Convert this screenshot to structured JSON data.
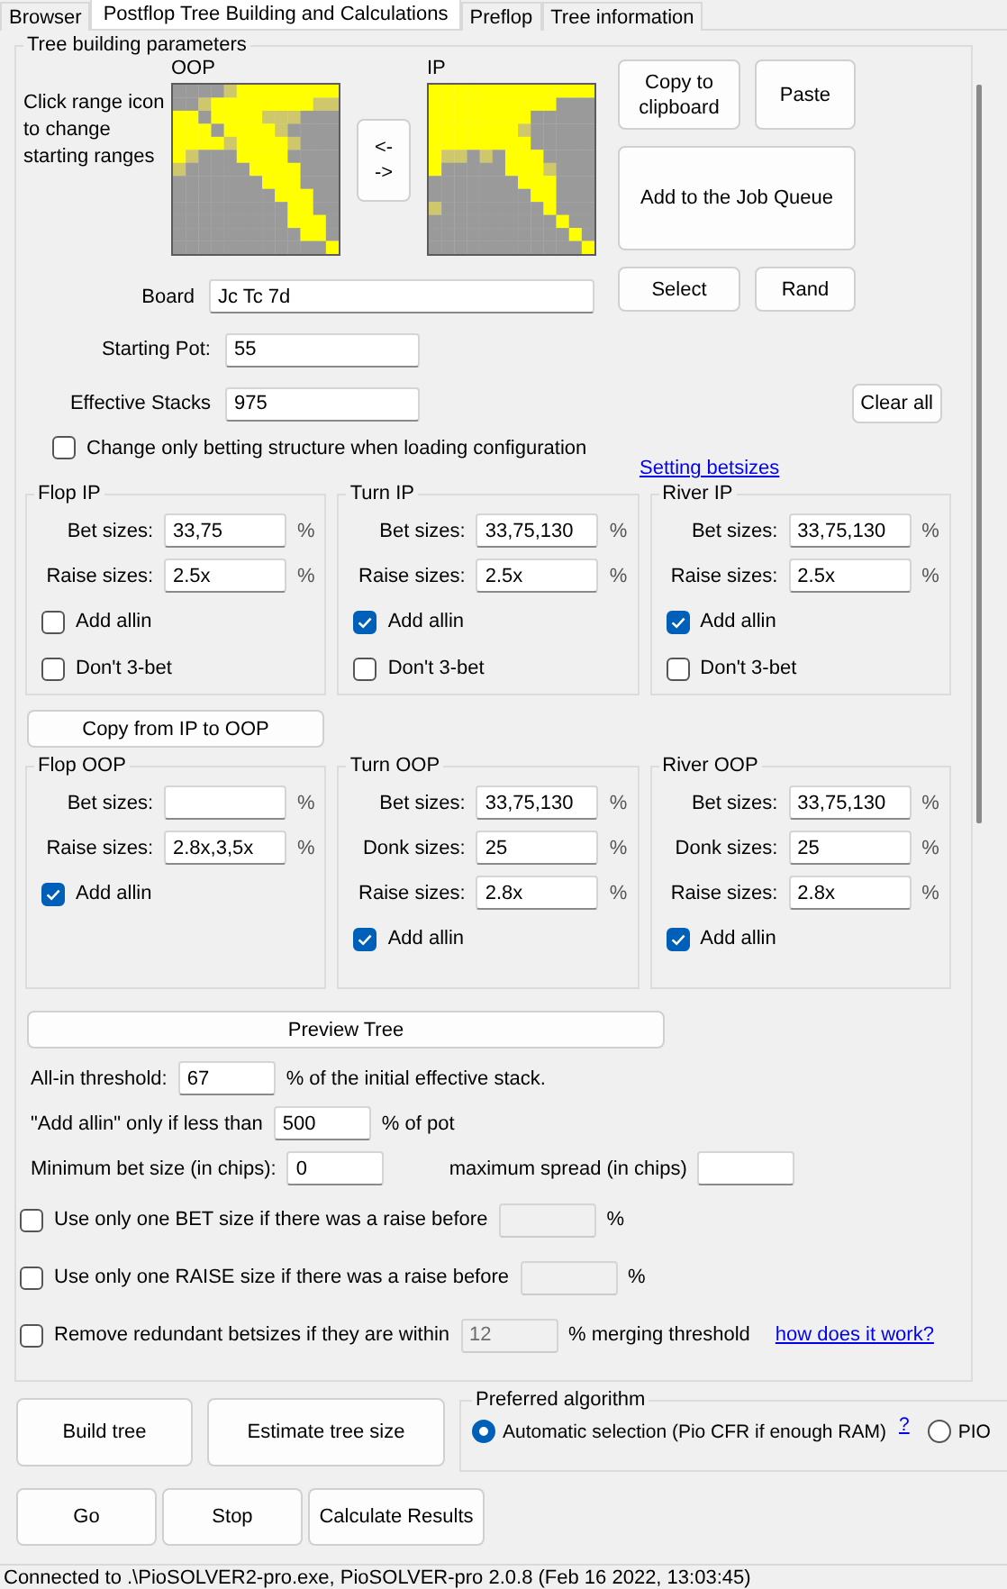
{
  "tabs": [
    {
      "label": "Browser",
      "selected": false
    },
    {
      "label": "Postflop Tree Building and Calculations",
      "selected": true
    },
    {
      "label": "Preflop",
      "selected": false
    },
    {
      "label": "Tree information",
      "selected": false
    }
  ],
  "group_title": "Tree building parameters",
  "ranges_hint": "Click range icon to change starting ranges",
  "ranges": [
    {
      "label": "OOP"
    },
    {
      "label": "IP"
    }
  ],
  "swap_button": "<- ->",
  "range_buttons": [
    "Copy to clipboard",
    "Paste",
    "Add to the Job Queue",
    "Select",
    "Rand"
  ],
  "board": {
    "label": "Board",
    "value": "Jc Tc 7d"
  },
  "starting_pot": {
    "label": "Starting Pot:",
    "value": "55"
  },
  "effective_stacks": {
    "label": "Effective Stacks",
    "value": "975"
  },
  "clear_all_button": "Clear all",
  "change_only": {
    "label": "Change only betting structure when loading configuration",
    "checked": false
  },
  "setting_betsizes_link": "Setting betsizes",
  "ip_groups": [
    {
      "title": "Flop IP",
      "rows": [
        {
          "label": "Bet sizes:",
          "value": "33,75",
          "unit": "%"
        },
        {
          "label": "Raise sizes:",
          "value": "2.5x",
          "unit": "%"
        }
      ],
      "checkboxes": [
        {
          "label": "Add allin",
          "checked": false
        },
        {
          "label": "Don't 3-bet",
          "checked": false
        }
      ]
    },
    {
      "title": "Turn IP",
      "rows": [
        {
          "label": "Bet sizes:",
          "value": "33,75,130",
          "unit": "%"
        },
        {
          "label": "Raise sizes:",
          "value": "2.5x",
          "unit": "%"
        }
      ],
      "checkboxes": [
        {
          "label": "Add allin",
          "checked": true
        },
        {
          "label": "Don't 3-bet",
          "checked": false
        }
      ]
    },
    {
      "title": "River IP",
      "rows": [
        {
          "label": "Bet sizes:",
          "value": "33,75,130",
          "unit": "%"
        },
        {
          "label": "Raise sizes:",
          "value": "2.5x",
          "unit": "%"
        }
      ],
      "checkboxes": [
        {
          "label": "Add allin",
          "checked": true
        },
        {
          "label": "Don't 3-bet",
          "checked": false
        }
      ]
    }
  ],
  "copy_button": "Copy from IP to OOP",
  "oop_groups": [
    {
      "title": "Flop OOP",
      "rows": [
        {
          "label": "Bet sizes:",
          "unit": "%"
        },
        {
          "label": "Raise sizes:",
          "value": "2.8x,3,5x",
          "unit": "%"
        }
      ],
      "checkboxes": [
        {
          "label": "Add allin",
          "checked": true
        }
      ]
    },
    {
      "title": "Turn OOP",
      "rows": [
        {
          "label": "Bet sizes:",
          "value": "33,75,130",
          "unit": "%"
        },
        {
          "label": "Donk sizes:",
          "value": "25",
          "unit": "%"
        },
        {
          "label": "Raise sizes:",
          "value": "2.8x",
          "unit": "%"
        }
      ],
      "checkboxes": [
        {
          "label": "Add allin",
          "checked": true
        }
      ]
    },
    {
      "title": "River OOP",
      "rows": [
        {
          "label": "Bet sizes:",
          "value": "33,75,130",
          "unit": "%"
        },
        {
          "label": "Donk sizes:",
          "value": "25",
          "unit": "%"
        },
        {
          "label": "Raise sizes:",
          "value": "2.8x",
          "unit": "%"
        }
      ],
      "checkboxes": [
        {
          "label": "Add allin",
          "checked": true
        }
      ]
    }
  ],
  "preview_button": "Preview Tree",
  "allin_threshold": {
    "label": "All-in threshold:",
    "value": "67",
    "suffix": "% of the initial effective stack."
  },
  "add_allin_limit": {
    "label": "\"Add allin\" only if less than",
    "value": "500",
    "suffix": "% of pot"
  },
  "min_bet": {
    "label": "Minimum bet size (in chips):",
    "value": "0"
  },
  "max_spread": {
    "label": "maximum spread (in chips)"
  },
  "options": [
    {
      "label": "Use only one BET size if there was a raise before",
      "checked": false,
      "field_disabled": true,
      "suffix": "%"
    },
    {
      "label": "Use only one RAISE size if there was a raise before",
      "checked": false,
      "field_disabled": true,
      "suffix": "%"
    },
    {
      "label": "Remove redundant betsizes if they are within",
      "checked": false,
      "field_disabled": true,
      "value": "12",
      "suffix": "% merging threshold",
      "link": "how does it work?"
    }
  ],
  "actions": [
    "Build tree",
    "Estimate tree size"
  ],
  "algorithm": {
    "title": "Preferred algorithm",
    "options": [
      {
        "label": "Automatic selection (Pio CFR if enough RAM)",
        "selected": true
      },
      {
        "label": "PIO",
        "selected": false
      }
    ],
    "help": "?"
  },
  "run_buttons": [
    "Go",
    "Stop",
    "Calculate Results"
  ],
  "status_bar": "Connected to .\\PioSOLVER2-pro.exe, PioSOLVER-pro 2.0.8 (Feb 16 2022, 13:03:45)"
}
